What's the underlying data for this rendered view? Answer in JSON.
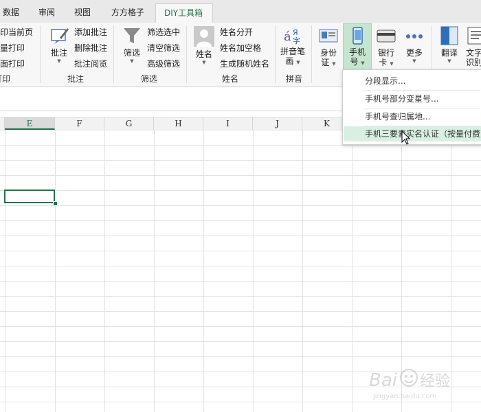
{
  "tabs": [
    {
      "label": "数据"
    },
    {
      "label": "审阅"
    },
    {
      "label": "视图"
    },
    {
      "label": "方方格子"
    },
    {
      "label": "DIY工具箱",
      "active": true
    }
  ],
  "ribbon": {
    "print_group": {
      "items": [
        "打印当前页",
        "批量打印",
        "双页面打印"
      ],
      "label": "打印"
    },
    "comment_group": {
      "big_button": "批注",
      "items": [
        "添加批注",
        "删除批注",
        "批注阅览"
      ],
      "label": "批注"
    },
    "filter_group": {
      "big_button": "筛选",
      "items": [
        "筛选选中",
        "清空筛选",
        "高级筛选"
      ],
      "label": "筛选"
    },
    "name_group": {
      "big_button": "姓名",
      "items": [
        "姓名分开",
        "姓名加空格",
        "生成随机姓名"
      ],
      "label": "姓名"
    },
    "pinyin_group": {
      "big_button_line1": "拼音笔",
      "big_button_line2": "画",
      "label": "拼音"
    },
    "id_group": {
      "id_line1": "身份",
      "id_line2": "证",
      "phone_line1": "手机",
      "phone_line2": "号",
      "bank_line1": "银行",
      "bank_line2": "卡",
      "more": "更多"
    },
    "translate_group": {
      "translate": "翻译",
      "ocr_line1": "文字",
      "ocr_line2": "识别"
    }
  },
  "dropdown": {
    "items": [
      "分段显示...",
      "手机号部分变星号...",
      "手机号查归属地...",
      "手机三要素实名认证（按量付费）"
    ],
    "highlighted_index": 3
  },
  "sheet": {
    "columns": [
      "E",
      "F",
      "G",
      "H",
      "I",
      "J",
      "K"
    ],
    "selected_column": "E"
  },
  "watermark": {
    "brand_left": "Bai",
    "brand_right": "经验",
    "url": "jingyan.baidu.com"
  },
  "colors": {
    "accent_green": "#217346",
    "highlight_green": "#c6e5d0",
    "ribbon_bg": "#f7f7f7"
  }
}
